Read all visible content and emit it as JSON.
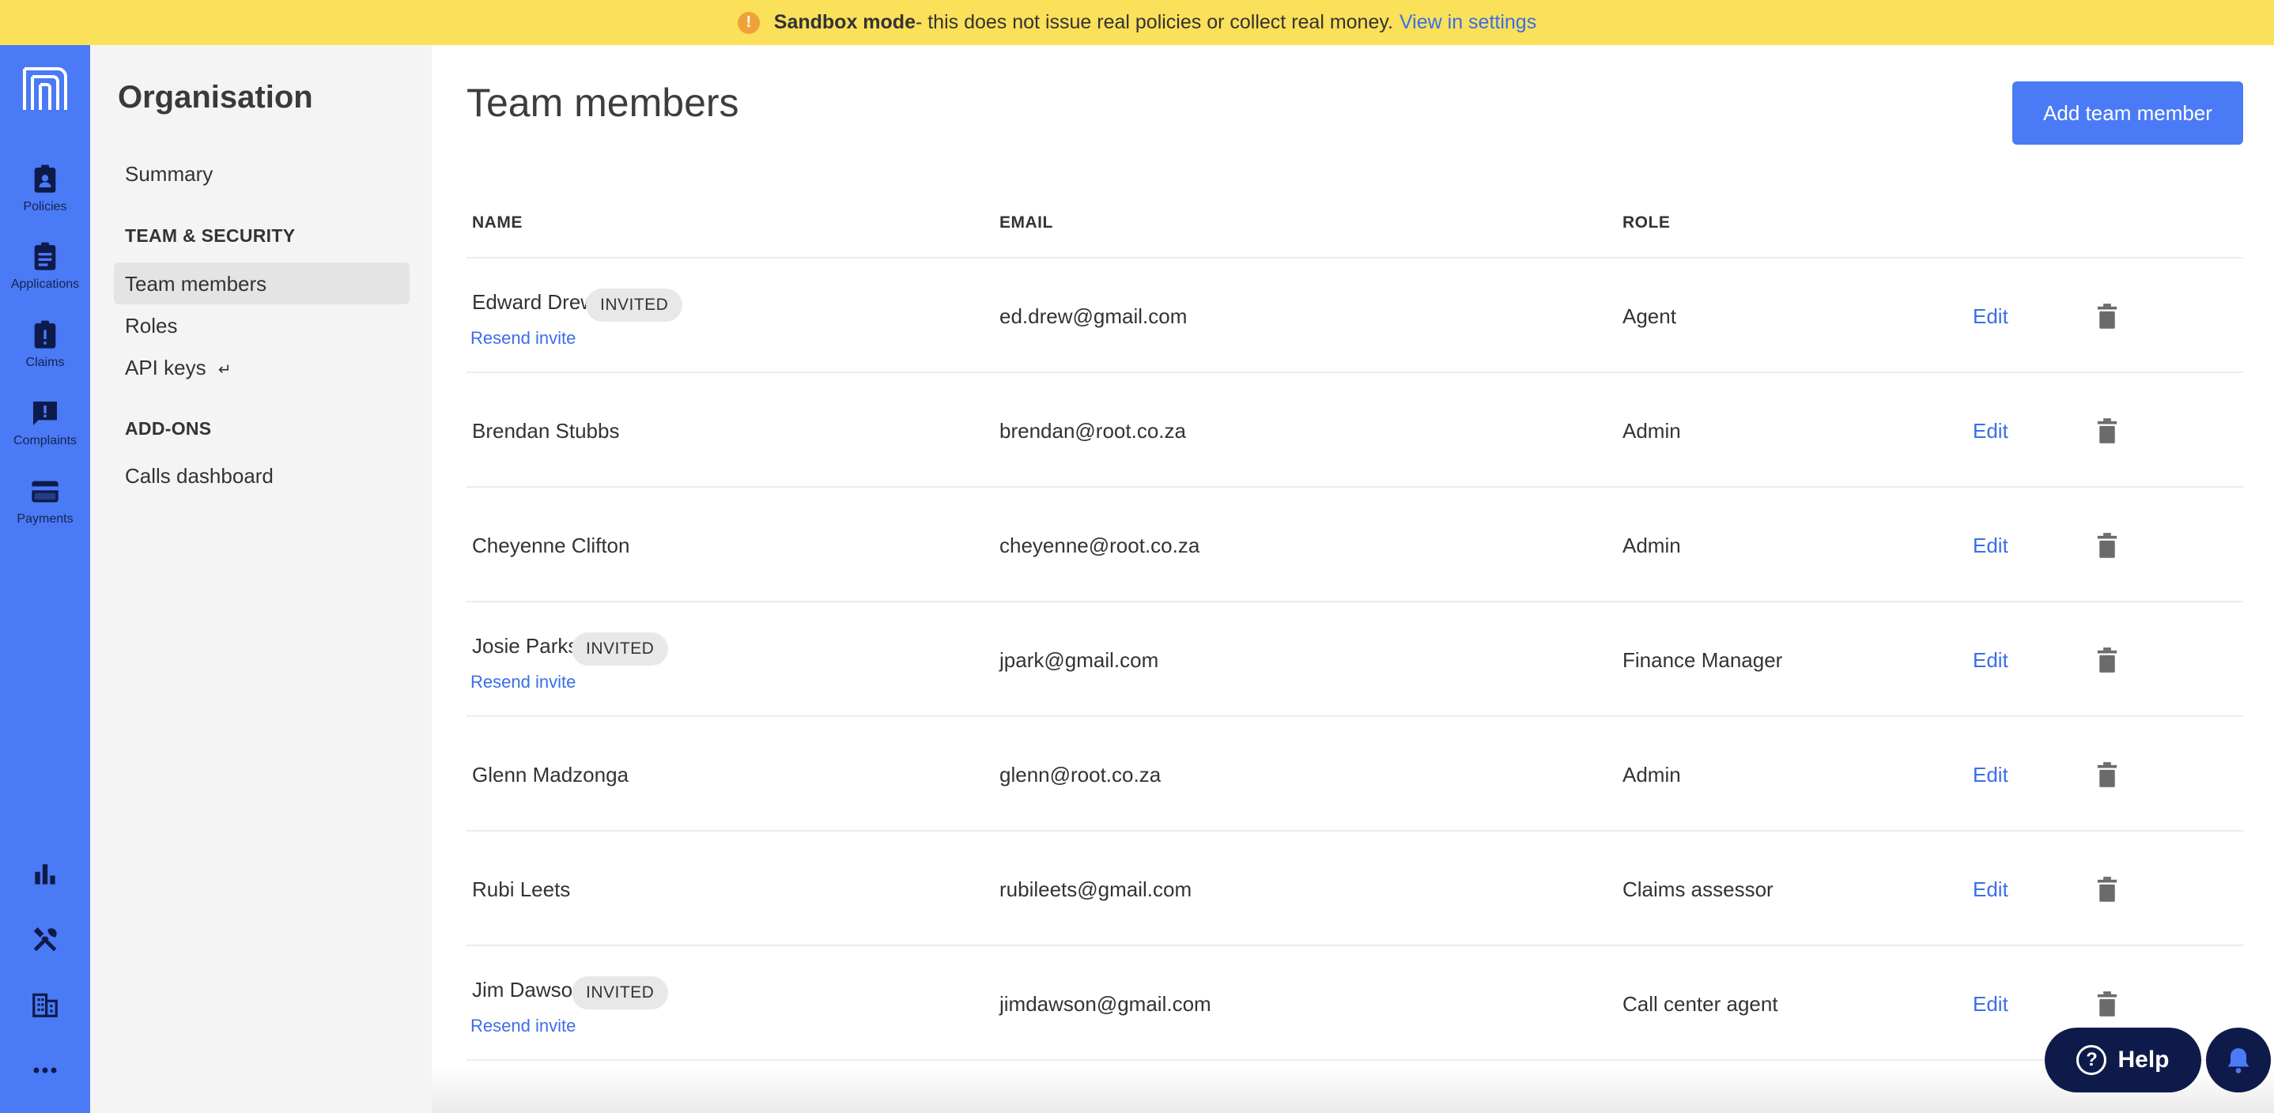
{
  "banner": {
    "icon": "warning-icon",
    "strong": "Sandbox mode",
    "text": " - this does not issue real policies or collect real money.",
    "link": "View in settings"
  },
  "rail": {
    "items": [
      {
        "label": "Policies",
        "icon": "policies-icon"
      },
      {
        "label": "Applications",
        "icon": "applications-icon"
      },
      {
        "label": "Claims",
        "icon": "claims-icon"
      },
      {
        "label": "Complaints",
        "icon": "complaints-icon"
      },
      {
        "label": "Payments",
        "icon": "payments-icon"
      }
    ],
    "bottom_icons": [
      "analytics-icon",
      "tools-icon",
      "organisation-icon",
      "more-icon"
    ]
  },
  "sidebar": {
    "title": "Organisation",
    "summary": "Summary",
    "section_team": "TEAM & SECURITY",
    "team_members": "Team members",
    "roles": "Roles",
    "api_keys": "API keys",
    "api_keys_icon": "return-arrow-icon",
    "section_addons": "ADD-ONS",
    "calls_dashboard": "Calls dashboard"
  },
  "main": {
    "title": "Team members",
    "add_button": "Add team member",
    "columns": {
      "name": "NAME",
      "email": "EMAIL",
      "role": "ROLE"
    },
    "edit_label": "Edit",
    "invited_label": "INVITED",
    "resend_label": "Resend invite",
    "members": [
      {
        "name": "Edward Drew",
        "invited": true,
        "email": "ed.drew@gmail.com",
        "role": "Agent"
      },
      {
        "name": "Brendan Stubbs",
        "invited": false,
        "email": "brendan@root.co.za",
        "role": "Admin"
      },
      {
        "name": "Cheyenne Clifton",
        "invited": false,
        "email": "cheyenne@root.co.za",
        "role": "Admin"
      },
      {
        "name": "Josie Parks",
        "invited": true,
        "email": "jpark@gmail.com",
        "role": "Finance Manager"
      },
      {
        "name": "Glenn Madzonga",
        "invited": false,
        "email": "glenn@root.co.za",
        "role": "Admin"
      },
      {
        "name": "Rubi Leets",
        "invited": false,
        "email": "rubileets@gmail.com",
        "role": "Claims assessor"
      },
      {
        "name": "Jim Dawson",
        "invited": true,
        "email": "jimdawson@gmail.com",
        "role": "Call center agent"
      }
    ]
  },
  "help": {
    "label": "Help"
  },
  "colors": {
    "accent": "#4a7af5",
    "banner": "#fbe05a",
    "navy": "#0e1b4a",
    "link": "#3a6ee8"
  }
}
